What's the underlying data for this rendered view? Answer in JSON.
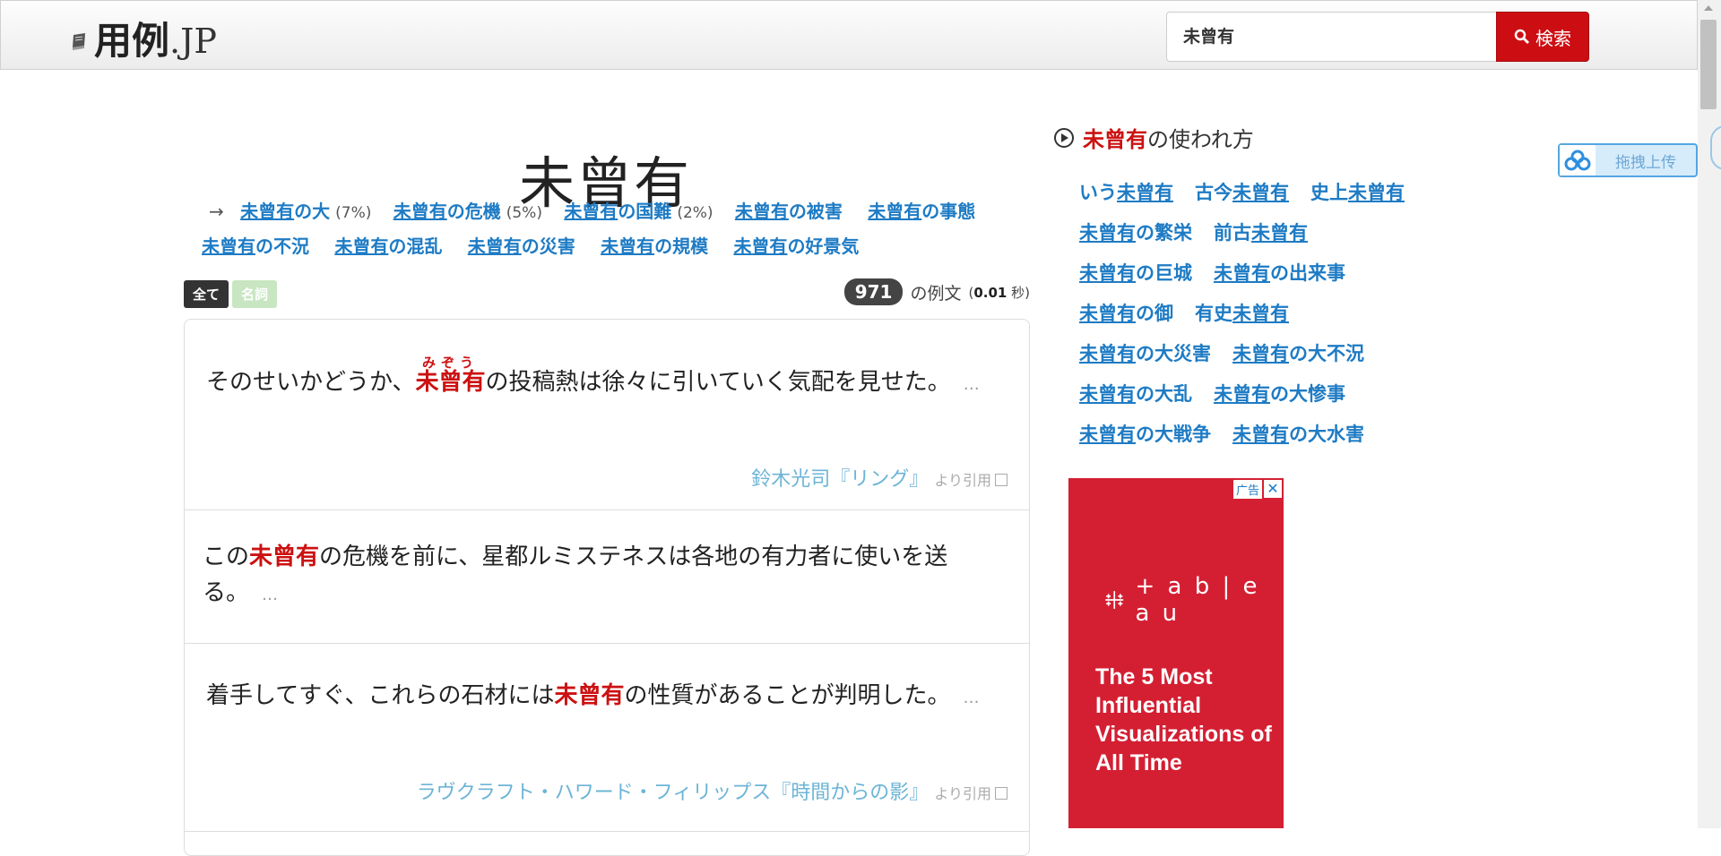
{
  "header": {
    "logo_text": "用例",
    "logo_suffix": ".JP",
    "search_value": "未曾有",
    "search_button": "検索"
  },
  "page": {
    "title": "未曾有"
  },
  "related": {
    "arrow": "→",
    "items": [
      {
        "head": "未曾有",
        "tail": "の大",
        "pct": "(7%)"
      },
      {
        "head": "未曾有",
        "tail": "の危機",
        "pct": "(5%)"
      },
      {
        "head": "未曾有",
        "tail": "の国難",
        "pct": "(2%)"
      },
      {
        "head": "未曾有",
        "tail": "の被害",
        "pct": ""
      },
      {
        "head": "未曾有",
        "tail": "の事態",
        "pct": ""
      },
      {
        "head": "未曾有",
        "tail": "の不況",
        "pct": ""
      },
      {
        "head": "未曾有",
        "tail": "の混乱",
        "pct": ""
      },
      {
        "head": "未曾有",
        "tail": "の災害",
        "pct": ""
      },
      {
        "head": "未曾有",
        "tail": "の規模",
        "pct": ""
      },
      {
        "head": "未曾有",
        "tail": "の好景気",
        "pct": ""
      }
    ]
  },
  "filters": {
    "all": "全て",
    "noun": "名詞"
  },
  "results": {
    "count": "971",
    "label": "の例文",
    "time_open": "(",
    "time": "0.01",
    "time_unit": "秒)"
  },
  "examples": [
    {
      "before": "そのせいかどうか、",
      "highlight": "未曾有",
      "ruby": "みぞう",
      "after": "の投稿熱は徐々に引いていく気配を見せた。",
      "more": "…",
      "author": "鈴木光司『リング』",
      "cite_suffix": "より引用"
    },
    {
      "before": "この",
      "highlight": "未曾有",
      "after": "の危機を前に、星都ルミステネスは各地の有力者に使いを送る。",
      "more": "…"
    },
    {
      "before": "着手してすぐ、これらの石材には",
      "highlight": "未曾有",
      "after": "の性質があることが判明した。",
      "more": "…",
      "author": "ラヴクラフト・ハワード・フィリップス『時間からの影』",
      "cite_suffix": "より引用"
    }
  ],
  "usage": {
    "head_hl": "未曾有",
    "head_rest": "の使われ方",
    "rows": [
      [
        {
          "pre": "いう",
          "hl": "未曾有",
          "post": ""
        },
        {
          "pre": "古今",
          "hl": "未曾有",
          "post": ""
        },
        {
          "pre": "史上",
          "hl": "未曾有",
          "post": ""
        }
      ],
      [
        {
          "pre": "",
          "hl": "未曾有",
          "post": "の繁栄"
        },
        {
          "pre": "前古",
          "hl": "未曾有",
          "post": ""
        }
      ],
      [
        {
          "pre": "",
          "hl": "未曾有",
          "post": "の巨城"
        },
        {
          "pre": "",
          "hl": "未曾有",
          "post": "の出来事"
        }
      ],
      [
        {
          "pre": "",
          "hl": "未曾有",
          "post": "の御"
        },
        {
          "pre": "有史",
          "hl": "未曾有",
          "post": ""
        }
      ],
      [
        {
          "pre": "",
          "hl": "未曾有",
          "post": "の大災害"
        },
        {
          "pre": "",
          "hl": "未曾有",
          "post": "の大不況"
        }
      ],
      [
        {
          "pre": "",
          "hl": "未曾有",
          "post": "の大乱"
        },
        {
          "pre": "",
          "hl": "未曾有",
          "post": "の大惨事"
        }
      ],
      [
        {
          "pre": "",
          "hl": "未曾有",
          "post": "の大戦争"
        },
        {
          "pre": "",
          "hl": "未曾有",
          "post": "の大水害"
        }
      ]
    ]
  },
  "float_upload": {
    "label": "拖拽上传"
  },
  "ad": {
    "badge": "广告",
    "close": "✕",
    "brand": "+ a b | e a u",
    "headline": "The 5 Most Influential Visualizations of All Time"
  },
  "colors": {
    "accent": "#cc0e13",
    "link": "#1e7bc4",
    "ad_bg": "#d41f33"
  }
}
